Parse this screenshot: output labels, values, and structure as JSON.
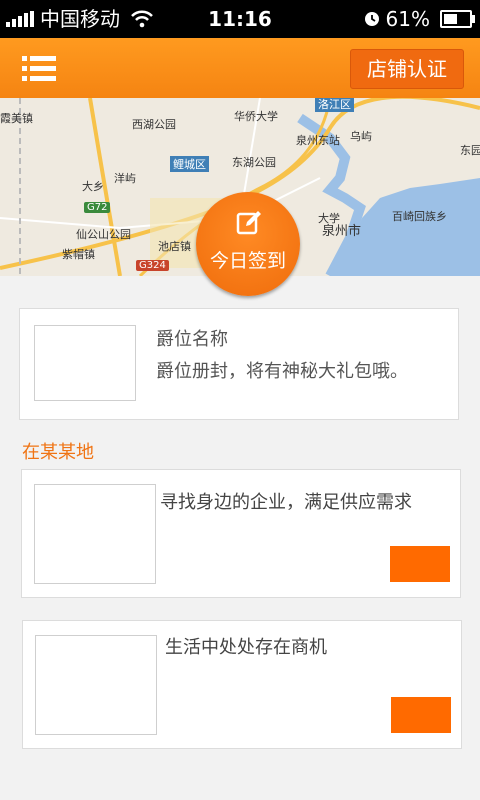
{
  "status_bar": {
    "carrier": "中国移动",
    "time": "11:16",
    "battery_text": "61%",
    "battery_level": 0.61
  },
  "nav": {
    "menu_icon": "menu-icon",
    "shop_cert_label": "店铺认证"
  },
  "map": {
    "labels": [
      "霞美镇",
      "西湖公园",
      "华侨大学",
      "洛江区",
      "泉州东站",
      "乌屿",
      "东园",
      "鲤城区",
      "东湖公园",
      "大乡",
      "洋屿",
      "仙公山公园",
      "紫帽镇",
      "池店镇",
      "泉州市",
      "百崎回族乡",
      "大学"
    ],
    "road_shields": [
      "G72",
      "G324"
    ]
  },
  "checkin": {
    "label": "今日签到",
    "icon": "edit-icon"
  },
  "rank_card": {
    "title": "爵位名称",
    "description": "爵位册封，将有神秘大礼包哦。"
  },
  "location_label": "在某某地",
  "items": [
    {
      "text": "寻找身边的企业，满足供应需求"
    },
    {
      "text": "生活中处处存在商机"
    }
  ],
  "colors": {
    "accent": "#f58412",
    "button": "#ff6a00",
    "location": "#f07414"
  }
}
